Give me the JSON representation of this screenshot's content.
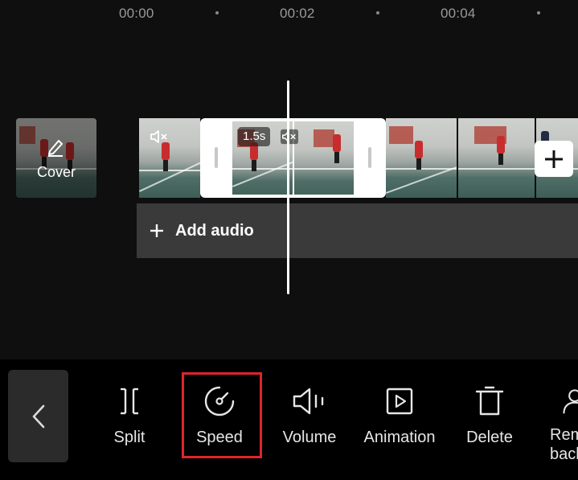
{
  "timeline": {
    "ruler": [
      "00:00",
      "00:02",
      "00:04"
    ],
    "cover_label": "Cover",
    "clip_duration": "1.5s",
    "add_audio_label": "Add audio"
  },
  "toolbar": {
    "back_icon": "chevron-left-icon",
    "items": [
      {
        "label": "Split",
        "icon": "split-icon"
      },
      {
        "label": "Speed",
        "icon": "speed-icon"
      },
      {
        "label": "Volume",
        "icon": "volume-icon"
      },
      {
        "label": "Animation",
        "icon": "animation-icon"
      },
      {
        "label": "Delete",
        "icon": "delete-icon"
      },
      {
        "label": "Remove\nbacke",
        "icon": "remove-background-icon"
      }
    ]
  },
  "colors": {
    "highlight": "#e0242b",
    "background": "#0f0f0f",
    "toolbar": "#000000",
    "audio_track": "#3a3a3a"
  }
}
